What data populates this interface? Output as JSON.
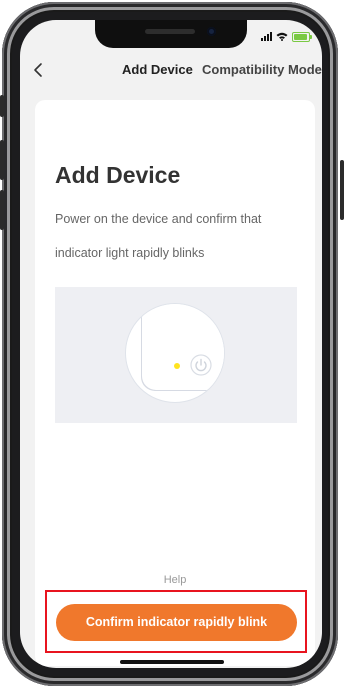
{
  "nav": {
    "title": "Add Device",
    "compatibility_mode": "Compatibility Mode"
  },
  "card": {
    "title": "Add Device",
    "description": "Power on the device and confirm that indicator light rapidly blinks"
  },
  "footer": {
    "help": "Help",
    "confirm_button": "Confirm indicator rapidly blink"
  },
  "colors": {
    "accent": "#f0782c",
    "highlight": "#e8141f",
    "indicator": "#ffe31f",
    "battery": "#7ac943"
  },
  "icons": [
    "back-chevron-icon",
    "signal-icon",
    "wifi-icon",
    "battery-icon",
    "power-icon"
  ]
}
